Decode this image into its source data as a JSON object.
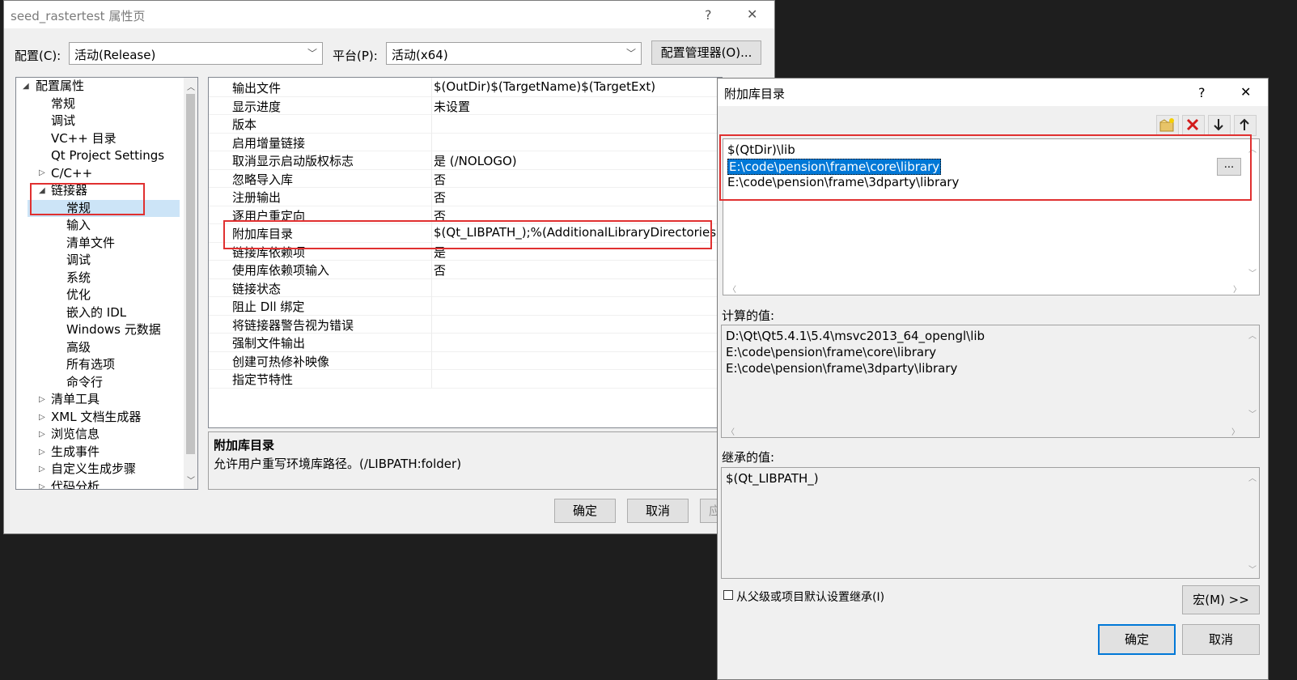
{
  "main_window": {
    "title": "seed_rastertest 属性页",
    "help": "?",
    "close": "✕",
    "config_label": "配置(C):",
    "config_value": "活动(Release)",
    "platform_label": "平台(P):",
    "platform_value": "活动(x64)",
    "config_manager": "配置管理器(O)...",
    "ok": "确定",
    "cancel": "取消",
    "apply_partial": "应"
  },
  "tree": {
    "items": [
      {
        "label": "配置属性",
        "toggle": "◢"
      },
      {
        "label": "常规"
      },
      {
        "label": "调试"
      },
      {
        "label": "VC++ 目录"
      },
      {
        "label": "Qt Project Settings"
      },
      {
        "label": "C/C++",
        "toggle": "▷"
      },
      {
        "label": "链接器",
        "toggle": "◢"
      },
      {
        "label": "常规"
      },
      {
        "label": "输入"
      },
      {
        "label": "清单文件"
      },
      {
        "label": "调试"
      },
      {
        "label": "系统"
      },
      {
        "label": "优化"
      },
      {
        "label": "嵌入的 IDL"
      },
      {
        "label": "Windows 元数据"
      },
      {
        "label": "高级"
      },
      {
        "label": "所有选项"
      },
      {
        "label": "命令行"
      },
      {
        "label": "清单工具",
        "toggle": "▷"
      },
      {
        "label": "XML 文档生成器",
        "toggle": "▷"
      },
      {
        "label": "浏览信息",
        "toggle": "▷"
      },
      {
        "label": "生成事件",
        "toggle": "▷"
      },
      {
        "label": "自定义生成步骤",
        "toggle": "▷"
      },
      {
        "label": "代码分析",
        "toggle": "▷"
      }
    ]
  },
  "grid": {
    "rows": [
      {
        "key": "输出文件",
        "value": "$(OutDir)$(TargetName)$(TargetExt)"
      },
      {
        "key": "显示进度",
        "value": "未设置"
      },
      {
        "key": "版本",
        "value": ""
      },
      {
        "key": "启用增量链接",
        "value": ""
      },
      {
        "key": "取消显示启动版权标志",
        "value": "是 (/NOLOGO)"
      },
      {
        "key": "忽略导入库",
        "value": "否"
      },
      {
        "key": "注册输出",
        "value": "否"
      },
      {
        "key": "逐用户重定向",
        "value": "否"
      },
      {
        "key": "附加库目录",
        "value": "$(Qt_LIBPATH_);%(AdditionalLibraryDirectories)"
      },
      {
        "key": "链接库依赖项",
        "value": "是"
      },
      {
        "key": "使用库依赖项输入",
        "value": "否"
      },
      {
        "key": "链接状态",
        "value": ""
      },
      {
        "key": "阻止 Dll 绑定",
        "value": ""
      },
      {
        "key": "将链接器警告视为错误",
        "value": ""
      },
      {
        "key": "强制文件输出",
        "value": ""
      },
      {
        "key": "创建可热修补映像",
        "value": ""
      },
      {
        "key": "指定节特性",
        "value": ""
      }
    ]
  },
  "description": {
    "title": "附加库目录",
    "text": "允许用户重写环境库路径。(/LIBPATH:folder)"
  },
  "dialog": {
    "title": "附加库目录",
    "help": "?",
    "close": "✕",
    "toolbar": [
      "new-folder-icon",
      "delete-icon",
      "move-down-icon",
      "move-up-icon"
    ],
    "entries": [
      "$(QtDir)\\lib",
      "E:\\code\\pension\\frame\\core\\library",
      "E:\\code\\pension\\frame\\3dparty\\library"
    ],
    "browse_button": "...",
    "computed_label": "计算的值:",
    "computed": [
      "D:\\Qt\\Qt5.4.1\\5.4\\msvc2013_64_opengl\\lib",
      "E:\\code\\pension\\frame\\core\\library",
      "E:\\code\\pension\\frame\\3dparty\\library"
    ],
    "inherited_label": "继承的值:",
    "inherited": [
      "$(Qt_LIBPATH_)"
    ],
    "inherit_checkbox": "从父级或项目默认设置继承(I)",
    "macro_button": "宏(M) >>",
    "ok": "确定",
    "cancel": "取消"
  },
  "colors": {
    "highlight": "#0078d7",
    "annotation_red": "#e03030",
    "selection_light": "#cce4f7"
  }
}
